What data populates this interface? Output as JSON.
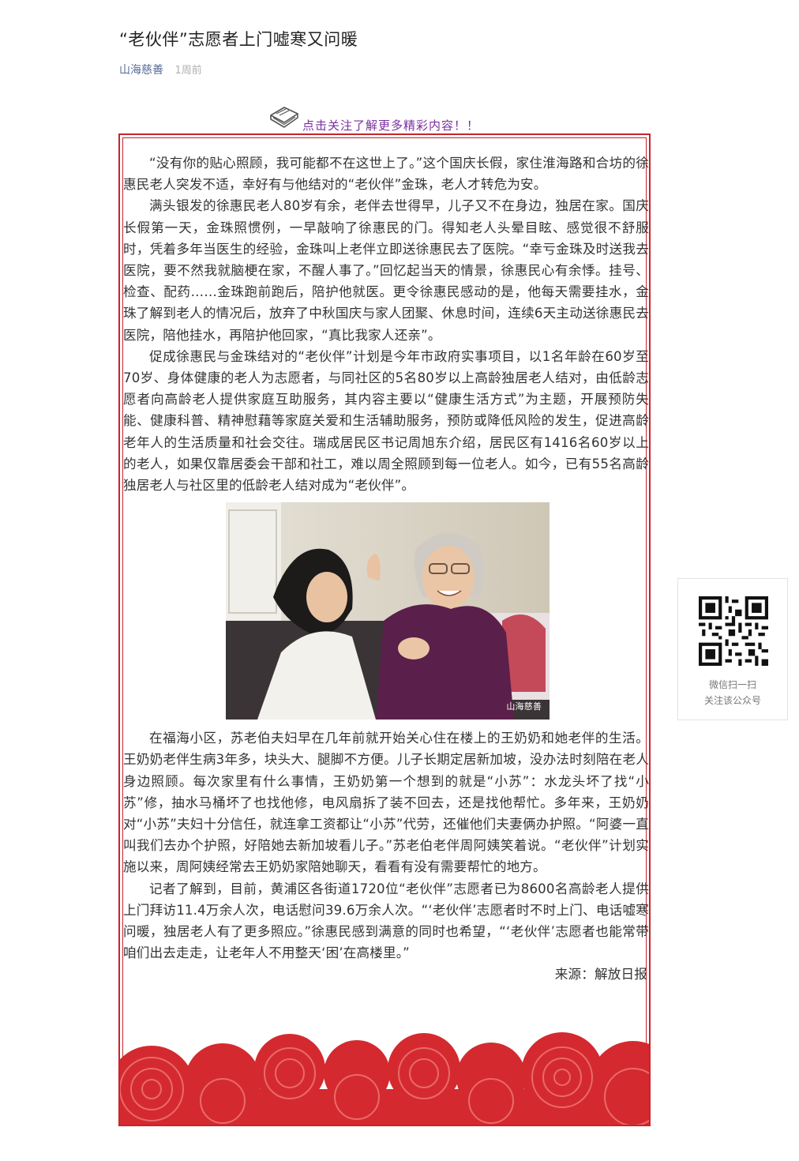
{
  "article": {
    "title": "“老伙伴”志愿者上门嘘寒又问暖",
    "author": "山海慈善",
    "time": "1周前"
  },
  "follow_banner": {
    "text": "点击关注了解更多精彩内容！！",
    "icon": "book-icon"
  },
  "paragraphs": [
    "“没有你的贴心照顾，我可能都不在这世上了。”这个国庆长假，家住淮海路和合坊的徐惠民老人突发不适，幸好有与他结对的“老伙伴”金珠，老人才转危为安。",
    "满头银发的徐惠民老人80岁有余，老伴去世得早，儿子又不在身边，独居在家。国庆长假第一天，金珠照惯例，一早敲响了徐惠民的门。得知老人头晕目眩、感觉很不舒服时，凭着多年当医生的经验，金珠叫上老伴立即送徐惠民去了医院。“幸亏金珠及时送我去医院，要不然我就脑梗在家，不醒人事了。”回忆起当天的情景，徐惠民心有余悸。挂号、检查、配药……金珠跑前跑后，陪护他就医。更令徐惠民感动的是，他每天需要挂水，金珠了解到老人的情况后，放弃了中秋国庆与家人团聚、休息时间，连续6天主动送徐惠民去医院，陪他挂水，再陪护他回家，“真比我家人还亲”。",
    "促成徐惠民与金珠结对的“老伙伴”计划是今年市政府实事项目，以1名年龄在60岁至70岁、身体健康的老人为志愿者，与同社区的5名80岁以上高龄独居老人结对，由低龄志愿者向高龄老人提供家庭互助服务，其内容主要以“健康生活方式”为主题，开展预防失能、健康科普、精神慰藉等家庭关爱和生活辅助服务，预防或降低风险的发生，促进高龄老年人的生活质量和社会交往。瑞成居民区书记周旭东介绍，居民区有1416名60岁以上的老人，如果仅靠居委会干部和社工，难以周全照顾到每一位老人。如今，已有55名高龄独居老人与社区里的低龄老人结对成为“老伙伴”。"
  ],
  "photo": {
    "watermark": "山海慈善"
  },
  "paragraphs_after": [
    "在福海小区，苏老伯夫妇早在几年前就开始关心住在楼上的王奶奶和她老伴的生活。王奶奶老伴生病3年多，块头大、腿脚不方便。儿子长期定居新加坡，没办法时刻陪在老人身边照顾。每次家里有什么事情，王奶奶第一个想到的就是“小苏”：水龙头坏了找“小苏”修，抽水马桶坏了也找他修，电风扇拆了装不回去，还是找他帮忙。多年来，王奶奶对“小苏”夫妇十分信任，就连拿工资都让“小苏”代劳，还催他们夫妻俩办护照。“阿婆一直叫我们去办个护照，好陪她去新加坡看儿子。”苏老伯老伴周阿姨笑着说。“老伙伴”计划实施以来，周阿姨经常去王奶奶家陪她聊天，看看有没有需要帮忙的地方。",
    "记者了解到，目前，黄浦区各街道1720位“老伙伴”志愿者已为8600名高龄老人提供上门拜访11.4万余人次，电话慰问39.6万余人次。“‘老伙伴’志愿者时不时上门、电话嘘寒问暖，独居老人有了更多照应。”徐惠民感到满意的同时也希望，“‘老伙伴’志愿者也能常带咱们出去走走，让老年人不用整天‘困’在高楼里。”"
  ],
  "source": "来源：解放日报",
  "qr": {
    "line1": "微信扫一扫",
    "line2": "关注该公众号"
  },
  "colors": {
    "border": "#c7242c",
    "author_link": "#576b95",
    "banner_text": "#7a2fa0",
    "cloud": "#d42a2f"
  }
}
